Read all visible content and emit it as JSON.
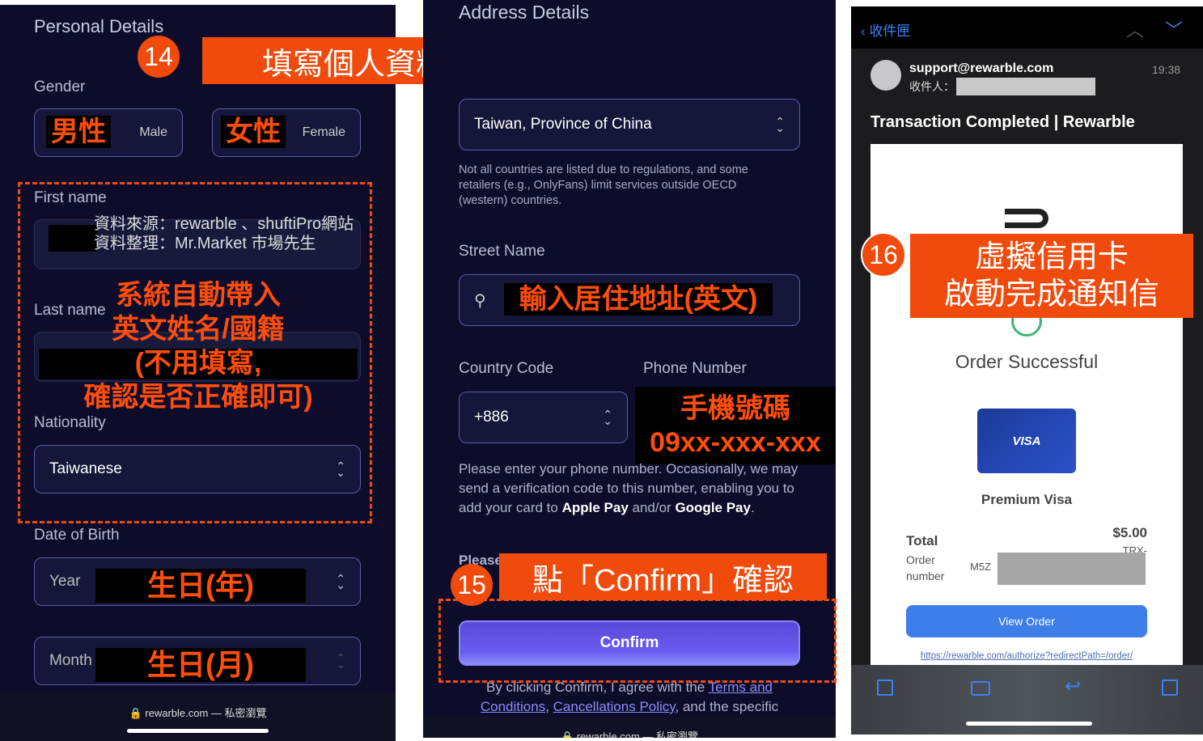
{
  "left": {
    "section_title": "Personal Details",
    "gender_label": "Gender",
    "male": "Male",
    "female": "Female",
    "male_annotation": "男性",
    "female_annotation": "女性",
    "first_name_label": "First name",
    "last_name_label": "Last name",
    "watermark_line1": "資料來源：rewarble 、shuftiPro網站",
    "watermark_line2": "資料整理：Mr.Market 市場先生",
    "auto_fill_annotation": [
      "系統自動帶入",
      "英文姓名/國籍",
      "(不用填寫,",
      "確認是否正確即可)"
    ],
    "nationality_label": "Nationality",
    "nationality_value": "Taiwanese",
    "dob_label": "Date of Birth",
    "year_placeholder": "Year",
    "month_placeholder": "Month",
    "year_annotation": "生日(年)",
    "month_annotation": "生日(月)",
    "url_bar": "rewarble.com — 私密瀏覽",
    "step_badge": "14",
    "step_banner": "填寫個人資料和住址"
  },
  "middle": {
    "section_title": "Address Details",
    "country_value": "Taiwan, Province of China",
    "country_note": "Not all countries are listed due to regulations, and some retailers (e.g., OnlyFans) limit services outside OECD (western) countries.",
    "street_label": "Street Name",
    "street_annotation": "輸入居住地址(英文)",
    "country_code_label": "Country Code",
    "phone_label": "Phone Number",
    "country_code_value": "+886",
    "phone_annotation_1": "手機號碼",
    "phone_annotation_2": "09xx-xxx-xxx",
    "phone_help_1": "Please enter your phone number. Occasionally, we may send a verification code to this number, enabling you to add your card to ",
    "apple_pay": "Apple Pay",
    "and_or": " and/or ",
    "google_pay": "Google Pay",
    "period": ".",
    "please_partial": "Please",
    "step_badge": "15",
    "step_banner": "點「Confirm」確認",
    "confirm_button": "Confirm",
    "terms_prefix": "By clicking Confirm, I agree with the ",
    "terms_link": "Terms and Conditions",
    "comma": ", ",
    "cancel_link": "Cancellations Policy",
    "terms_suffix": ", and the specific",
    "url_bar": "rewarble.com — 私密瀏覽"
  },
  "right": {
    "back_label": "收件匣",
    "sender": "support@rewarble.com",
    "time": "19:38",
    "to_label": "收件人：",
    "subject": "Transaction Completed | Rewarble",
    "step_badge": "16",
    "step_banner_1": "虛擬信用卡",
    "step_banner_2": "啟動完成通知信",
    "order_status": "Order Successful",
    "card_brand": "VISA",
    "card_name": "Premium Visa",
    "total_label": "Total",
    "total_value": "$5.00",
    "order_number_label": "Order number",
    "order_number_partial_1": "TRX-",
    "order_number_partial_2": "M5Z",
    "view_order_button": "View Order",
    "order_link": "https://rewarble.com/authorize?redirectPath=/order/",
    "colors": {
      "accent": "#3d7ee8",
      "annotation": "#f04a0c"
    }
  }
}
